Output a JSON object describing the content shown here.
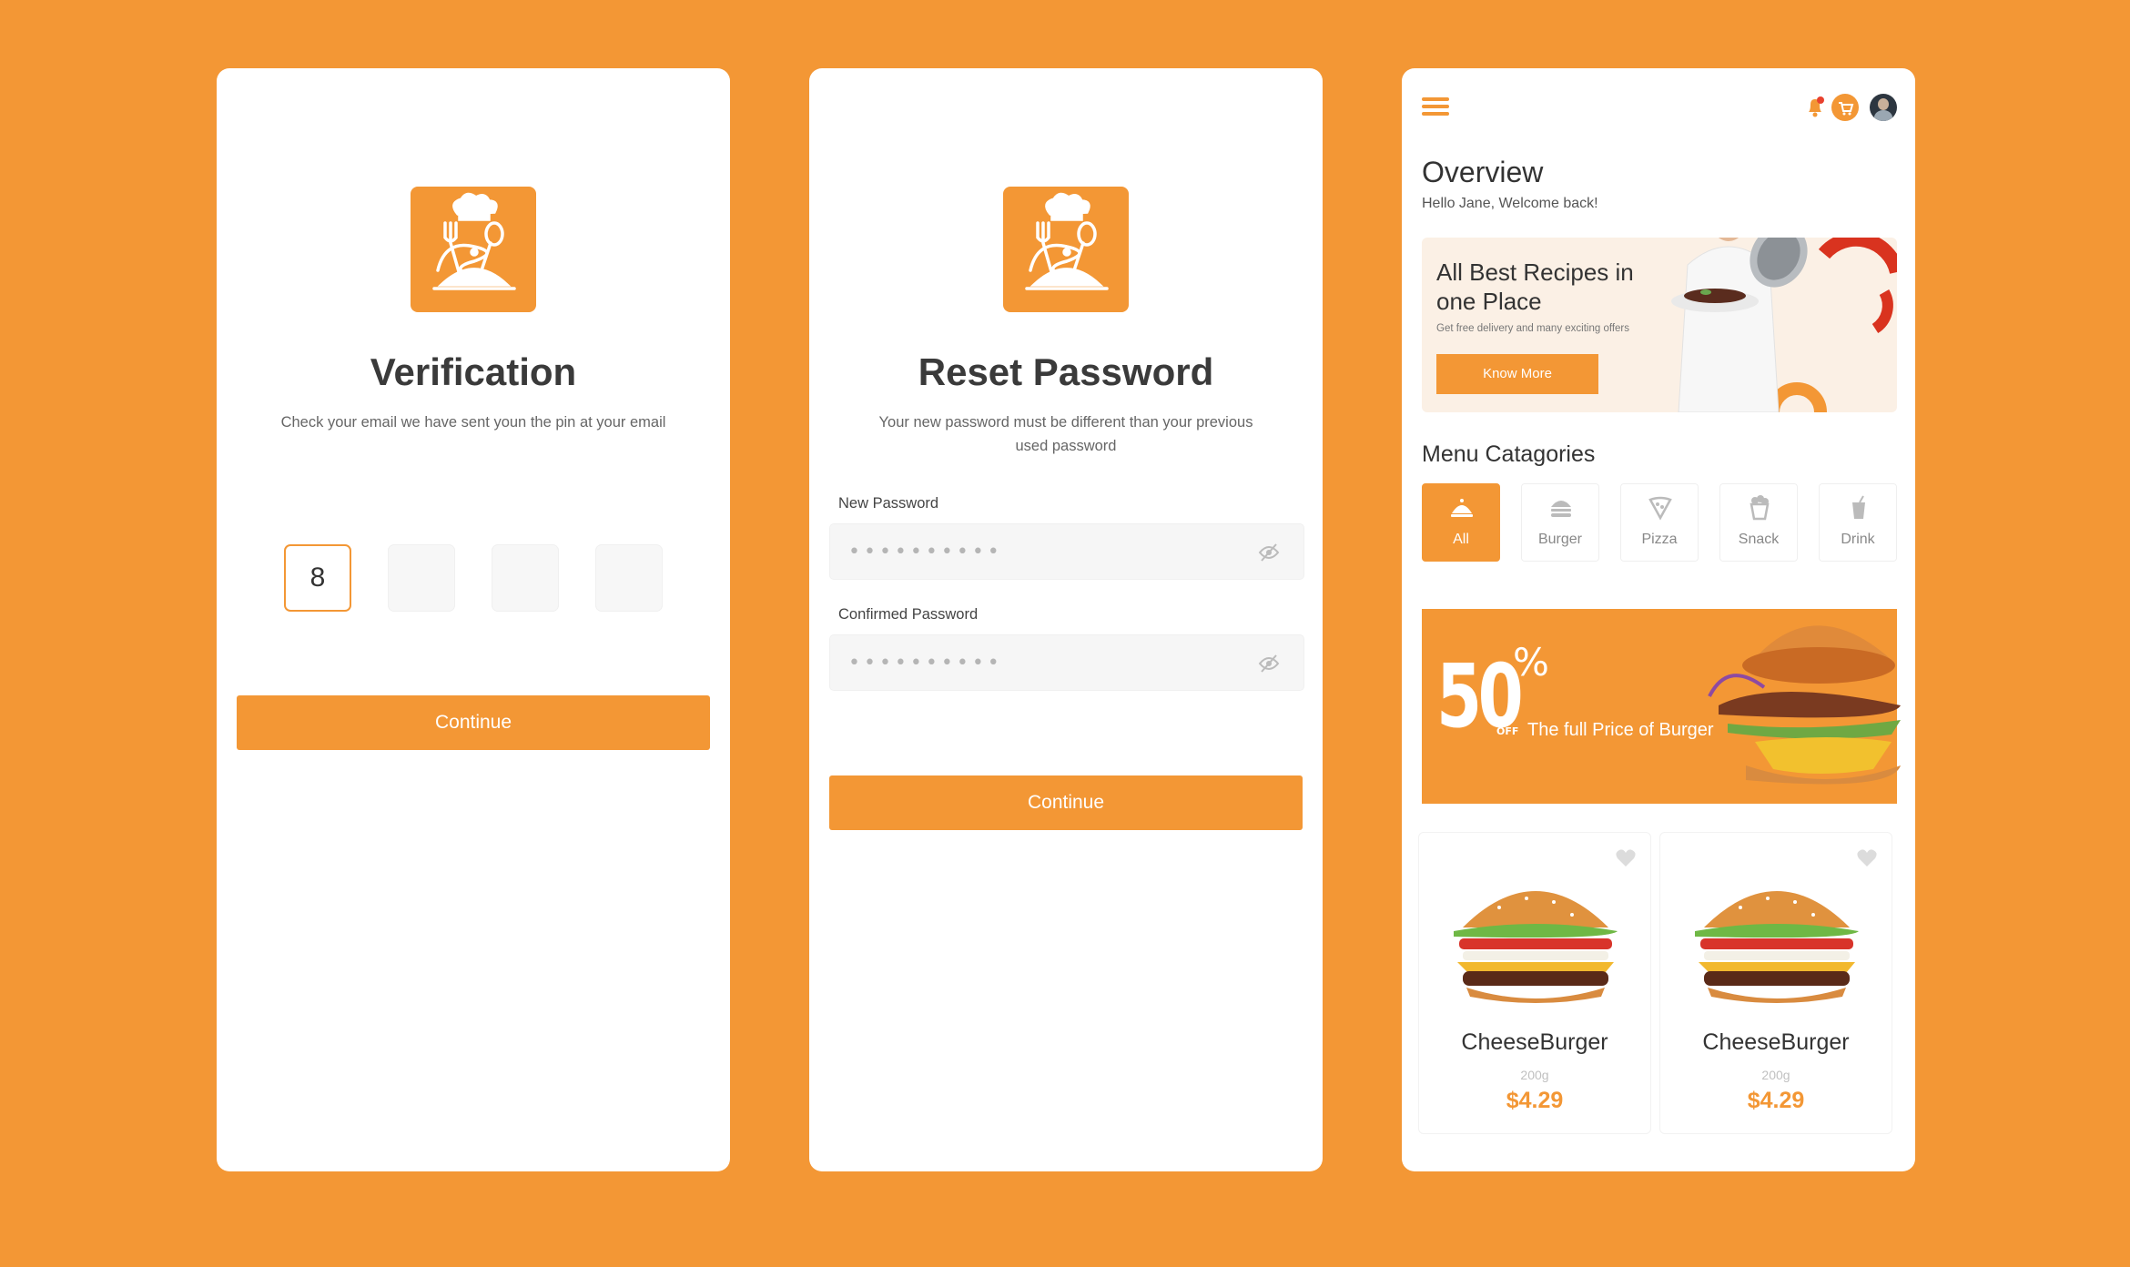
{
  "colors": {
    "accent": "#F39735",
    "background": "#F39735",
    "card": "#FFFFFF"
  },
  "verification": {
    "title": "Verification",
    "subtitle": "Check your email we have sent youn the pin at your email",
    "otp": [
      "8",
      "",
      "",
      ""
    ],
    "continue_label": "Continue"
  },
  "reset": {
    "title": "Reset Password",
    "subtitle": "Your new password must be different than your previous used password",
    "new_password_label": "New Password",
    "new_password_value": "••••••••••",
    "confirm_password_label": "Confirmed Password",
    "confirm_password_value": "••••••••••",
    "continue_label": "Continue"
  },
  "dashboard": {
    "title": "Overview",
    "greeting": "Hello Jane, Welcome back!",
    "promo": {
      "title": "All Best Recipes in one Place",
      "subtitle": "Get free delivery and many exciting offers",
      "button": "Know More"
    },
    "categories_title": "Menu Catagories",
    "categories": [
      {
        "label": "All",
        "icon": "cloche-icon",
        "active": true
      },
      {
        "label": "Burger",
        "icon": "burger-icon",
        "active": false
      },
      {
        "label": "Pizza",
        "icon": "pizza-icon",
        "active": false
      },
      {
        "label": "Snack",
        "icon": "popcorn-icon",
        "active": false
      },
      {
        "label": "Drink",
        "icon": "drink-icon",
        "active": false
      }
    ],
    "banner": {
      "big": "50",
      "pct": "%",
      "off": "OFF",
      "text": "The full Price of Burger"
    },
    "products": [
      {
        "name": "CheeseBurger",
        "weight": "200g",
        "price": "$4.29"
      },
      {
        "name": "CheeseBurger",
        "weight": "200g",
        "price": "$4.29"
      }
    ]
  }
}
